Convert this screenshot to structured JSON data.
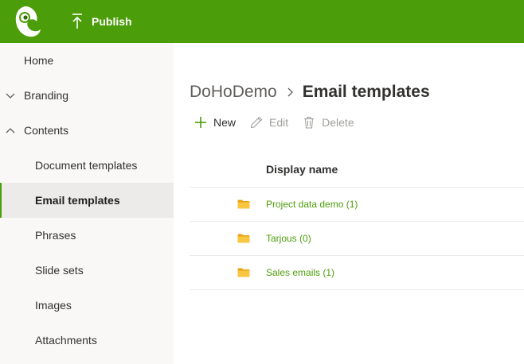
{
  "header": {
    "publish_label": "Publish",
    "brand_color": "#4c9d0a"
  },
  "sidebar": {
    "items": [
      {
        "label": "Home",
        "level": 0
      },
      {
        "label": "Branding",
        "level": 0,
        "expander": "chevron-down"
      },
      {
        "label": "Contents",
        "level": 0,
        "expander": "chevron-up"
      },
      {
        "label": "Document templates",
        "level": 1
      },
      {
        "label": "Email templates",
        "level": 1,
        "active": true
      },
      {
        "label": "Phrases",
        "level": 1
      },
      {
        "label": "Slide sets",
        "level": 1
      },
      {
        "label": "Images",
        "level": 1
      },
      {
        "label": "Attachments",
        "level": 1
      }
    ]
  },
  "breadcrumb": {
    "root": "DoHoDemo",
    "current": "Email templates"
  },
  "toolbar": {
    "new_label": "New",
    "edit_label": "Edit",
    "delete_label": "Delete"
  },
  "table": {
    "column_display_name": "Display name",
    "rows": [
      {
        "name": "Project data demo (1)",
        "icon": "folder-icon"
      },
      {
        "name": "Tarjous (0)",
        "icon": "folder-icon"
      },
      {
        "name": "Sales emails (1)",
        "icon": "folder-icon"
      }
    ]
  },
  "icons": {
    "logo": "chameleon-logo-icon",
    "publish": "upload-icon",
    "new": "plus-icon",
    "edit": "pencil-icon",
    "delete": "trash-icon",
    "folder": "folder-icon"
  }
}
